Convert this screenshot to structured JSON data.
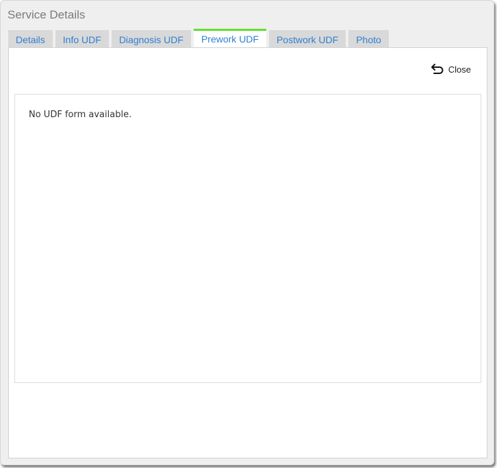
{
  "dialog": {
    "title": "Service Details"
  },
  "tabs": [
    {
      "label": "Details",
      "active": false
    },
    {
      "label": "Info UDF",
      "active": false
    },
    {
      "label": "Diagnosis UDF",
      "active": false
    },
    {
      "label": "Prework UDF",
      "active": true
    },
    {
      "label": "Postwork UDF",
      "active": false
    },
    {
      "label": "Photo",
      "active": false
    }
  ],
  "toolbar": {
    "close_label": "Close",
    "close_icon": "undo-arrow-icon"
  },
  "panel": {
    "message": "No UDF form available."
  },
  "colors": {
    "tab_text": "#2f7fcf",
    "active_tab_accent": "#5ee02c",
    "tab_background": "#d9d9d9",
    "dialog_background": "#efefef"
  }
}
